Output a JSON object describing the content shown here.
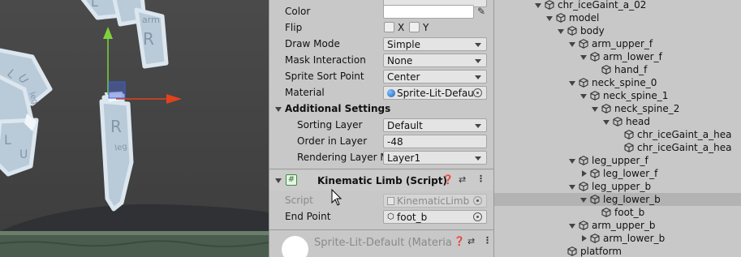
{
  "scene": {
    "labels": [
      "L",
      "arm",
      "R",
      "L",
      "U",
      "leg",
      "R",
      "leg",
      "L",
      "U"
    ]
  },
  "inspector": {
    "color_label": "Color",
    "flip_label": "Flip",
    "flip_x": "X",
    "flip_y": "Y",
    "draw_mode_label": "Draw Mode",
    "draw_mode_value": "Simple",
    "mask_label": "Mask Interaction",
    "mask_value": "None",
    "sort_point_label": "Sprite Sort Point",
    "sort_point_value": "Center",
    "material_label": "Material",
    "material_value": "Sprite-Lit-Defau",
    "additional_label": "Additional Settings",
    "sorting_layer_label": "Sorting Layer",
    "sorting_layer_value": "Default",
    "order_label": "Order in Layer",
    "order_value": "-48",
    "rendering_label": "Rendering Layer M",
    "rendering_value": "Layer1",
    "component_icon": "#",
    "component_title": "Kinematic Limb (Script)",
    "script_label": "Script",
    "script_value": "KinematicLimb",
    "end_point_label": "End Point",
    "end_point_value": "foot_b",
    "material_preview_label": "Sprite-Lit-Default (Materia"
  },
  "hierarchy": {
    "items": [
      {
        "label": "chr_iceGaint_a_02",
        "depth": 0,
        "expanded": "down",
        "selected": false
      },
      {
        "label": "model",
        "depth": 1,
        "expanded": "down",
        "selected": false
      },
      {
        "label": "body",
        "depth": 2,
        "expanded": "down",
        "selected": false
      },
      {
        "label": "arm_upper_f",
        "depth": 3,
        "expanded": "down",
        "selected": false
      },
      {
        "label": "arm_lower_f",
        "depth": 4,
        "expanded": "down",
        "selected": false
      },
      {
        "label": "hand_f",
        "depth": 5,
        "expanded": "none",
        "selected": false
      },
      {
        "label": "neck_spine_0",
        "depth": 3,
        "expanded": "down",
        "selected": false
      },
      {
        "label": "neck_spine_1",
        "depth": 4,
        "expanded": "down",
        "selected": false
      },
      {
        "label": "neck_spine_2",
        "depth": 5,
        "expanded": "down",
        "selected": false
      },
      {
        "label": "head",
        "depth": 6,
        "expanded": "down",
        "selected": false
      },
      {
        "label": "chr_iceGaint_a_hea",
        "depth": 7,
        "expanded": "none",
        "selected": false
      },
      {
        "label": "chr_iceGaint_a_hea",
        "depth": 7,
        "expanded": "none",
        "selected": false
      },
      {
        "label": "leg_upper_f",
        "depth": 3,
        "expanded": "down",
        "selected": false
      },
      {
        "label": "leg_lower_f",
        "depth": 4,
        "expanded": "right",
        "selected": false
      },
      {
        "label": "leg_upper_b",
        "depth": 3,
        "expanded": "down",
        "selected": false
      },
      {
        "label": "leg_lower_b",
        "depth": 4,
        "expanded": "down",
        "selected": true
      },
      {
        "label": "foot_b",
        "depth": 5,
        "expanded": "none",
        "selected": false
      },
      {
        "label": "arm_upper_b",
        "depth": 3,
        "expanded": "down",
        "selected": false
      },
      {
        "label": "arm_lower_b",
        "depth": 4,
        "expanded": "right",
        "selected": false
      },
      {
        "label": "platform",
        "depth": 2,
        "expanded": "none",
        "selected": false
      }
    ]
  },
  "colors": {
    "scene_bg": "#474747",
    "ice_fill": "#b9cad8",
    "ice_outline": "#dbe6ef",
    "gizmo_y": "#7fd13b",
    "gizmo_x": "#e2421c",
    "gizmo_center": "#3a5fd3",
    "ground": "#4a5c4e",
    "selection": "#b3b3b3"
  }
}
